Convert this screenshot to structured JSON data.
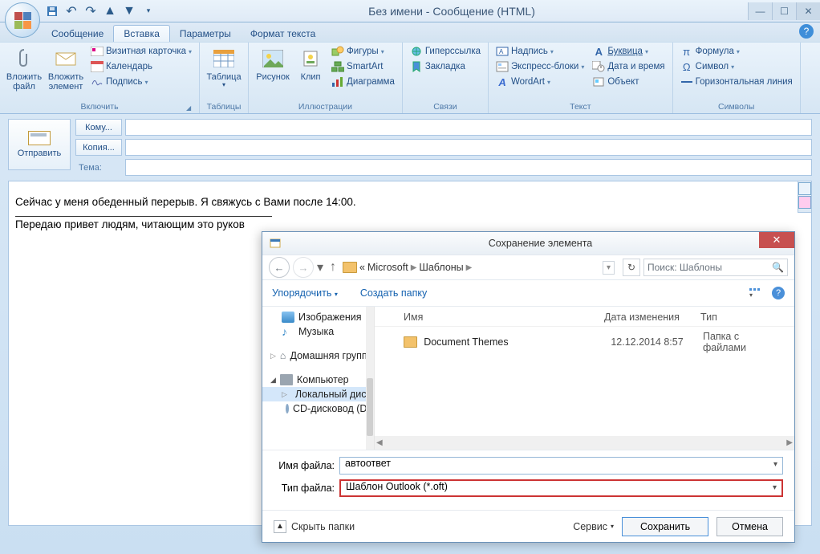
{
  "title": "Без имени - Сообщение (HTML)",
  "tabs": {
    "msg": "Сообщение",
    "insert": "Вставка",
    "options": "Параметры",
    "format": "Формат текста"
  },
  "ribbon": {
    "include": {
      "label": "Включить",
      "attach_file": "Вложить файл",
      "attach_item": "Вложить элемент",
      "bizcard": "Визитная карточка",
      "calendar": "Календарь",
      "signature": "Подпись"
    },
    "tables": {
      "label": "Таблицы",
      "table": "Таблица"
    },
    "illus": {
      "label": "Иллюстрации",
      "picture": "Рисунок",
      "clip": "Клип",
      "shapes": "Фигуры",
      "smartart": "SmartArt",
      "chart": "Диаграмма"
    },
    "links": {
      "label": "Связи",
      "hyperlink": "Гиперссылка",
      "bookmark": "Закладка"
    },
    "text": {
      "label": "Текст",
      "textbox": "Надпись",
      "quickparts": "Экспресс-блоки",
      "wordart": "WordArt",
      "dropcap": "Буквица",
      "datetime": "Дата и время",
      "object": "Объект"
    },
    "symbols": {
      "label": "Символы",
      "equation": "Формула",
      "symbol": "Символ",
      "hline": "Горизонтальная линия"
    }
  },
  "compose": {
    "send": "Отправить",
    "to": "Кому...",
    "cc": "Копия...",
    "subject": "Тема:"
  },
  "body": {
    "line1": "Сейчас у меня обеденный перерыв. Я свяжусь с Вами после 14:00.",
    "line2": "Передаю привет людям, читающим это руков"
  },
  "dialog": {
    "title": "Сохранение элемента",
    "breadcrumb": {
      "pre": "«",
      "a": "Microsoft",
      "b": "Шаблоны"
    },
    "search_placeholder": "Поиск: Шаблоны",
    "organize": "Упорядочить",
    "newfolder": "Создать папку",
    "tree": {
      "images": "Изображения",
      "music": "Музыка",
      "homegroup": "Домашняя группа",
      "computer": "Компьютер",
      "localdisk": "Локальный диск",
      "cddrive": "CD-дисковод (D:"
    },
    "columns": {
      "name": "Имя",
      "date": "Дата изменения",
      "type": "Тип"
    },
    "file": {
      "name": "Document Themes",
      "date": "12.12.2014 8:57",
      "type": "Папка с файлами"
    },
    "filename_label": "Имя файла:",
    "filename_value": "автоответ",
    "filetype_label": "Тип файла:",
    "filetype_value": "Шаблон Outlook (*.oft)",
    "hide_folders": "Скрыть папки",
    "tools": "Сервис",
    "save": "Сохранить",
    "cancel": "Отмена"
  }
}
